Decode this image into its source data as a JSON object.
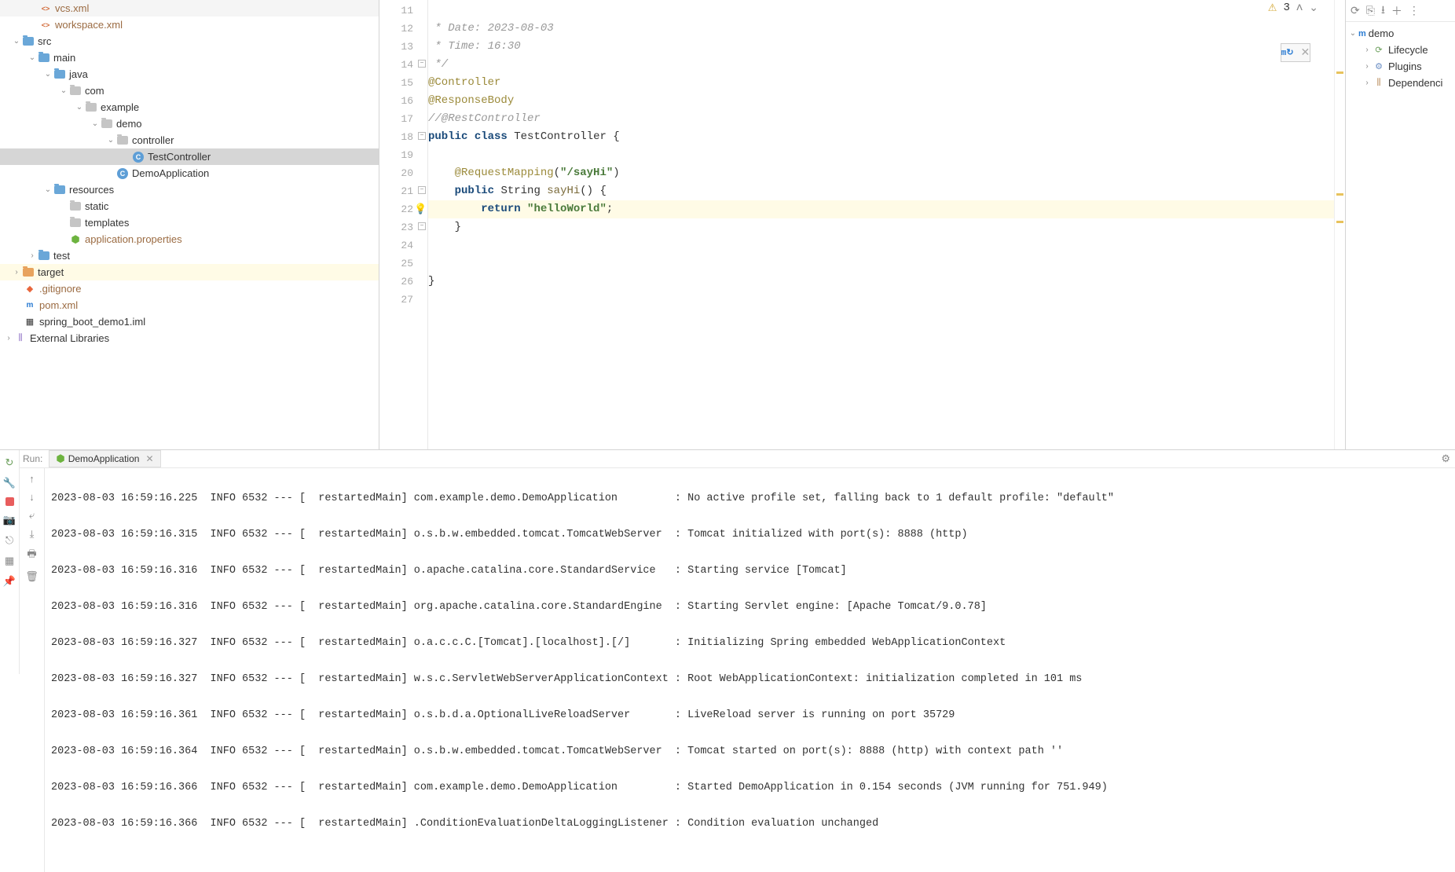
{
  "tree": {
    "vcs": "vcs.xml",
    "workspace": "workspace.xml",
    "src": "src",
    "main": "main",
    "java": "java",
    "com": "com",
    "example": "example",
    "demo": "demo",
    "controller": "controller",
    "testController": "TestController",
    "demoApp": "DemoApplication",
    "resources": "resources",
    "static": "static",
    "templates": "templates",
    "appProps": "application.properties",
    "test": "test",
    "target": "target",
    "gitignore": ".gitignore",
    "pom": "pom.xml",
    "iml": "spring_boot_demo1.iml",
    "extLib": "External Libraries"
  },
  "editor": {
    "warnings": "3",
    "lines": {
      "l11": "11",
      "l12": "12",
      "l13": "13",
      "l14": "14",
      "l15": "15",
      "l16": "16",
      "l17": "17",
      "l18": "18",
      "l19": "19",
      "l20": "20",
      "l21": "21",
      "l22": "22",
      "l23": "23",
      "l24": "24",
      "l25": "25",
      "l26": "26",
      "l27": "27"
    },
    "code": {
      "l12": " * Date: 2023-08-03",
      "l13": " * Time: 16:30",
      "l14": " */",
      "l15_anno": "@Controller",
      "l16_anno": "@ResponseBody",
      "l17": "//@RestController",
      "l18_kw1": "public",
      "l18_kw2": "class",
      "l18_cls": "TestController",
      "l18_brace": " {",
      "l20_anno": "@RequestMapping",
      "l20_paren": "(",
      "l20_str": "\"/sayHi\"",
      "l20_close": ")",
      "l21_kw": "public",
      "l21_type": "String",
      "l21_mth": "sayHi",
      "l21_rest": "() {",
      "l22_kw": "return",
      "l22_str": "\"helloWorld\"",
      "l22_semi": ";",
      "l23": "    }",
      "l26": "}"
    }
  },
  "maven": {
    "root": "demo",
    "lifecycle": "Lifecycle",
    "plugins": "Plugins",
    "deps": "Dependenci"
  },
  "run": {
    "label": "Run:",
    "tab": "DemoApplication",
    "log0": "2023-08-03 16:59:16.225  INFO 6532 --- [  restartedMain] com.example.demo.DemoApplication         : No active profile set, falling back to 1 default profile: \"default\"",
    "log1": "2023-08-03 16:59:16.315  INFO 6532 --- [  restartedMain] o.s.b.w.embedded.tomcat.TomcatWebServer  : Tomcat initialized with port(s): 8888 (http)",
    "log2": "2023-08-03 16:59:16.316  INFO 6532 --- [  restartedMain] o.apache.catalina.core.StandardService   : Starting service [Tomcat]",
    "log3": "2023-08-03 16:59:16.316  INFO 6532 --- [  restartedMain] org.apache.catalina.core.StandardEngine  : Starting Servlet engine: [Apache Tomcat/9.0.78]",
    "log4": "2023-08-03 16:59:16.327  INFO 6532 --- [  restartedMain] o.a.c.c.C.[Tomcat].[localhost].[/]       : Initializing Spring embedded WebApplicationContext",
    "log5": "2023-08-03 16:59:16.327  INFO 6532 --- [  restartedMain] w.s.c.ServletWebServerApplicationContext : Root WebApplicationContext: initialization completed in 101 ms",
    "log6": "2023-08-03 16:59:16.361  INFO 6532 --- [  restartedMain] o.s.b.d.a.OptionalLiveReloadServer       : LiveReload server is running on port 35729",
    "log7": "2023-08-03 16:59:16.364  INFO 6532 --- [  restartedMain] o.s.b.w.embedded.tomcat.TomcatWebServer  : Tomcat started on port(s): 8888 (http) with context path ''",
    "log8": "2023-08-03 16:59:16.366  INFO 6532 --- [  restartedMain] com.example.demo.DemoApplication         : Started DemoApplication in 0.154 seconds (JVM running for 751.949)",
    "log9": "2023-08-03 16:59:16.366  INFO 6532 --- [  restartedMain] .ConditionEvaluationDeltaLoggingListener : Condition evaluation unchanged"
  }
}
